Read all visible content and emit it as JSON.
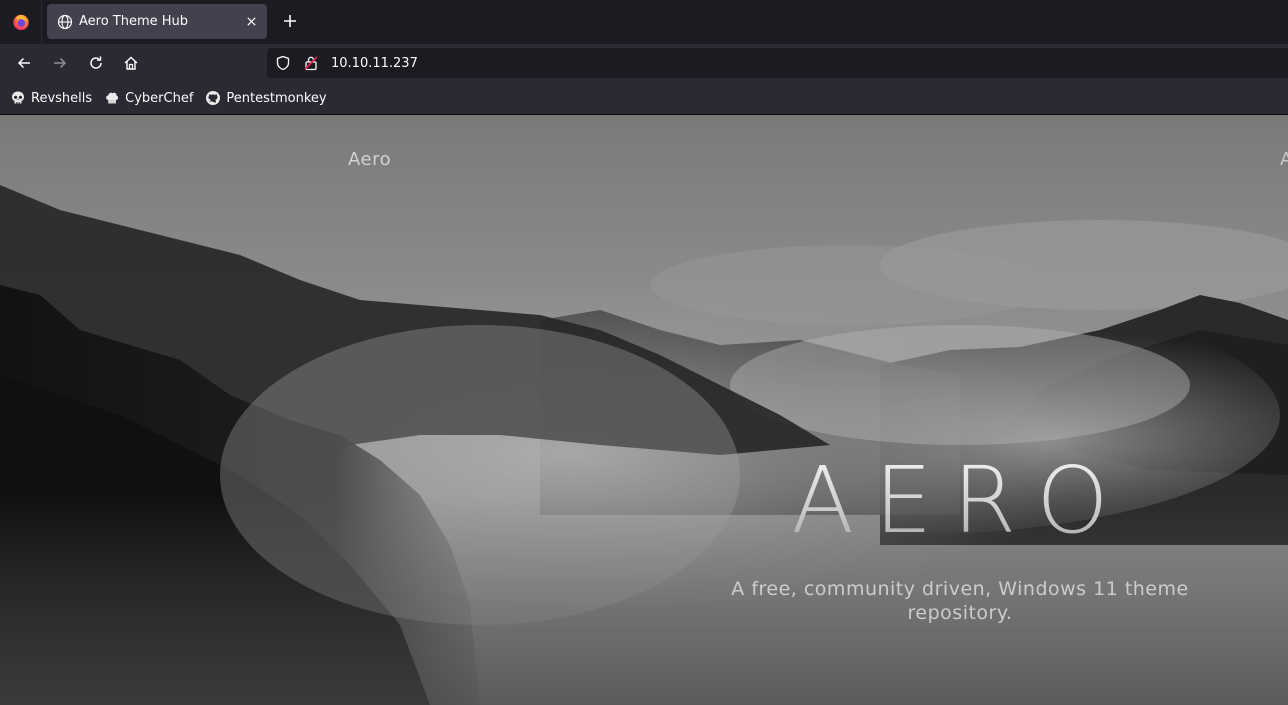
{
  "browser": {
    "tab": {
      "title": "Aero Theme Hub",
      "icon": "globe-icon"
    },
    "urlbar": {
      "url": "10.10.11.237"
    },
    "bookmarks": [
      {
        "label": "Revshells",
        "icon": "skull-icon"
      },
      {
        "label": "CyberChef",
        "icon": "chef-hat-icon"
      },
      {
        "label": "Pentestmonkey",
        "icon": "github-icon"
      }
    ]
  },
  "site": {
    "brand": "Aero",
    "nav_cut": "A",
    "hero_title": "AERO",
    "hero_subtitle": "A free, community driven, Windows 11 theme repository."
  },
  "colors": {
    "tabstrip": "#1c1b22",
    "toolbar": "#2b2a33",
    "active_tab": "#42414d"
  }
}
